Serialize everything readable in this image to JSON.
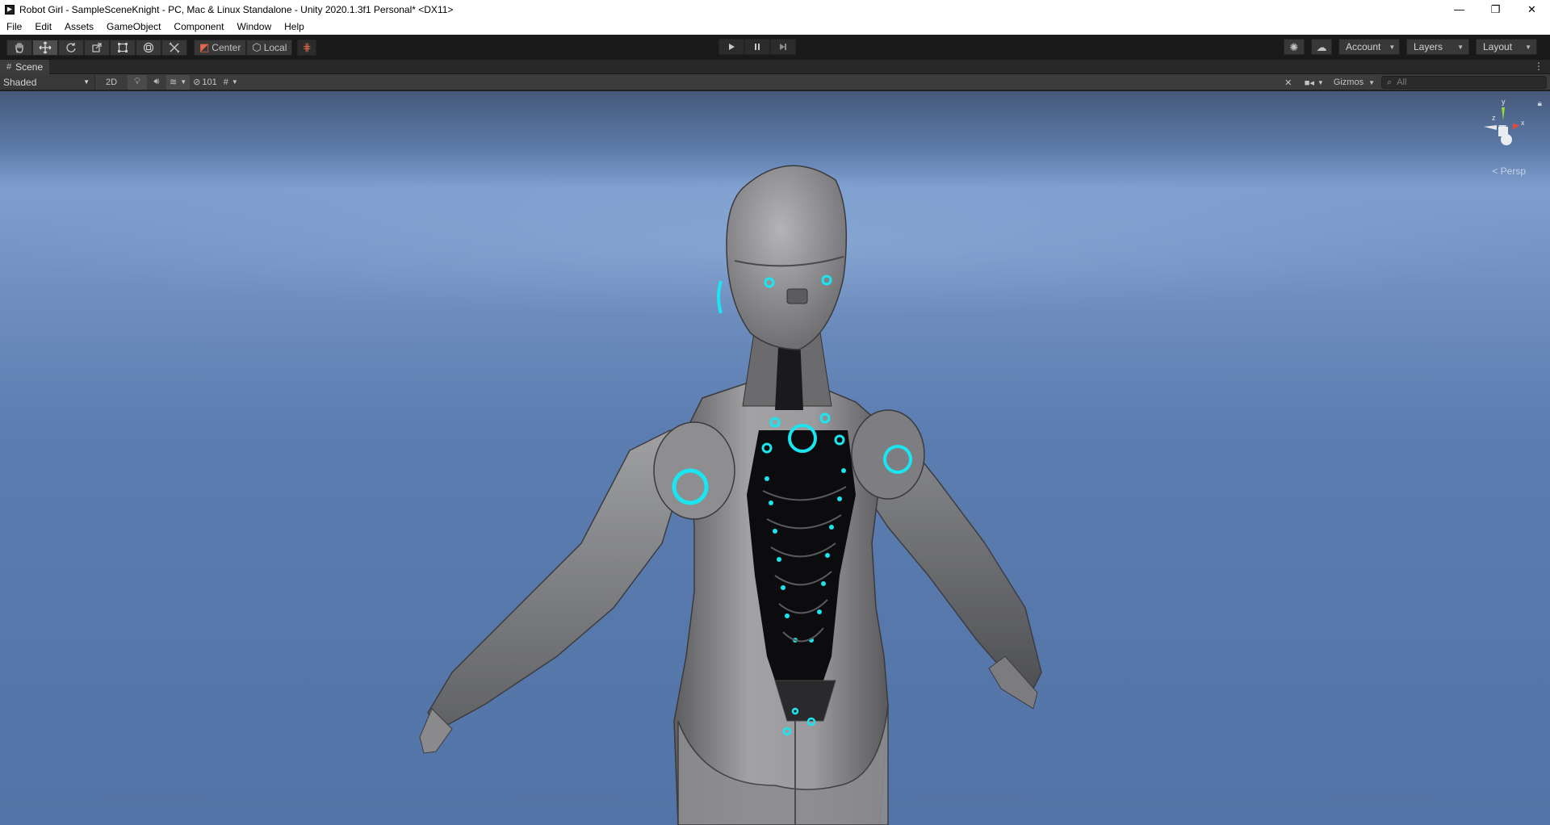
{
  "window": {
    "title": "Robot Girl - SampleSceneKnight - PC, Mac & Linux Standalone - Unity 2020.1.3f1 Personal* <DX11>",
    "controls": [
      "—",
      "❐",
      "✕"
    ]
  },
  "menu": [
    "File",
    "Edit",
    "Assets",
    "GameObject",
    "Component",
    "Window",
    "Help"
  ],
  "toolbar": {
    "tools": [
      "hand-tool",
      "move-tool",
      "rotate-tool",
      "scale-tool",
      "rect-tool",
      "transform-tool",
      "custom-tool"
    ],
    "active_tool": "move-tool",
    "pivot_mode": "Center",
    "pivot_rotation": "Local",
    "account_label": "Account",
    "layers_label": "Layers",
    "layout_label": "Layout"
  },
  "scene_tab": {
    "label": "Scene"
  },
  "scene_toolbar": {
    "draw_mode": "Shaded",
    "two_d_label": "2D",
    "hidden_count": "101",
    "gizmos_label": "Gizmos",
    "search_placeholder": "All"
  },
  "viewport": {
    "projection_label": "Persp",
    "axis_labels": {
      "x": "x",
      "y": "y",
      "z": "z"
    }
  },
  "colors": {
    "sky_top": "#46597a",
    "sky_mid": "#7f9fcf",
    "sky_bottom": "#5374a6",
    "robot_body": "#8c8c8c",
    "robot_glow": "#19e6f0",
    "spine_dark": "#0c0c0e"
  }
}
